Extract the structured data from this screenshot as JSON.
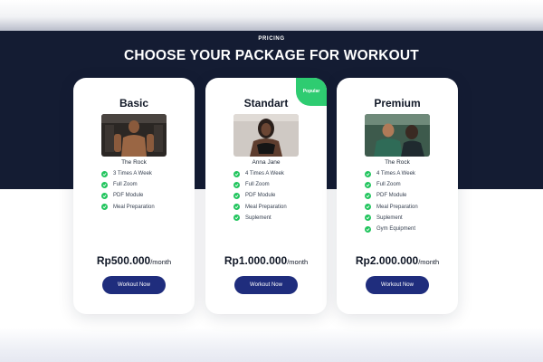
{
  "section": {
    "eyebrow": "PRICING",
    "headline": "CHOOSE YOUR PACKAGE FOR WORKOUT"
  },
  "colors": {
    "hero_bg": "#141c33",
    "button_bg": "#1f2d7d",
    "check": "#22c55e",
    "badge": "#2ecc71"
  },
  "plans": [
    {
      "name": "Basic",
      "trainer": "The Rock",
      "features": [
        "3 Times A Week",
        "Full Zoom",
        "PDF Module",
        "Meal Preparation"
      ],
      "price": "Rp500.000",
      "period": "/month",
      "button": "Workout Now"
    },
    {
      "name": "Standart",
      "badge": "Popular",
      "trainer": "Anna Jane",
      "features": [
        "4 Times A Week",
        "Full Zoom",
        "PDF Module",
        "Meal Preparation",
        "Suplement"
      ],
      "price": "Rp1.000.000",
      "period": "/month",
      "button": "Workout Now"
    },
    {
      "name": "Premium",
      "trainer": "The Rock",
      "features": [
        "4 Times A Week",
        "Full Zoom",
        "PDF Module",
        "Meal Preparation",
        "Suplement",
        "Gym Equipment"
      ],
      "price": "Rp2.000.000",
      "period": "/month",
      "button": "Workout Now"
    }
  ]
}
